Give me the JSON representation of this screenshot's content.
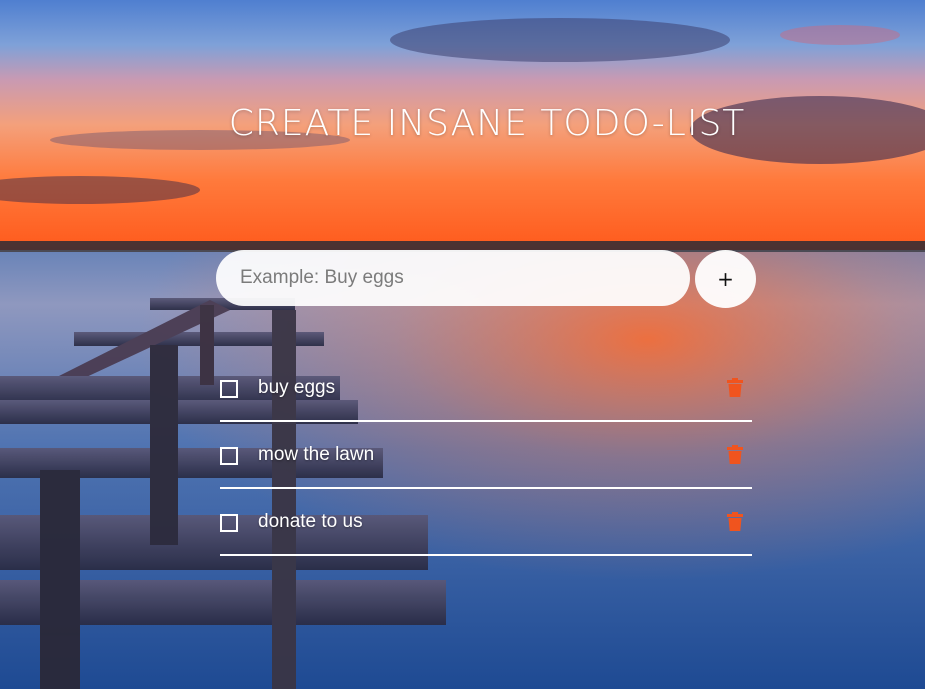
{
  "header": {
    "title": "CREATE INSANE TODO-LIST"
  },
  "new_todo": {
    "placeholder": "Example: Buy eggs",
    "value": "",
    "add_label": "+"
  },
  "todos": [
    {
      "text": "buy eggs",
      "done": false
    },
    {
      "text": "mow the lawn",
      "done": false
    },
    {
      "text": "donate to us",
      "done": false
    }
  ],
  "icons": {
    "add": "plus-icon",
    "delete": "trash-icon",
    "checkbox": "checkbox-icon"
  },
  "colors": {
    "delete_icon": "#f0541e",
    "divider": "#ffffff",
    "title": "#ffffff"
  }
}
